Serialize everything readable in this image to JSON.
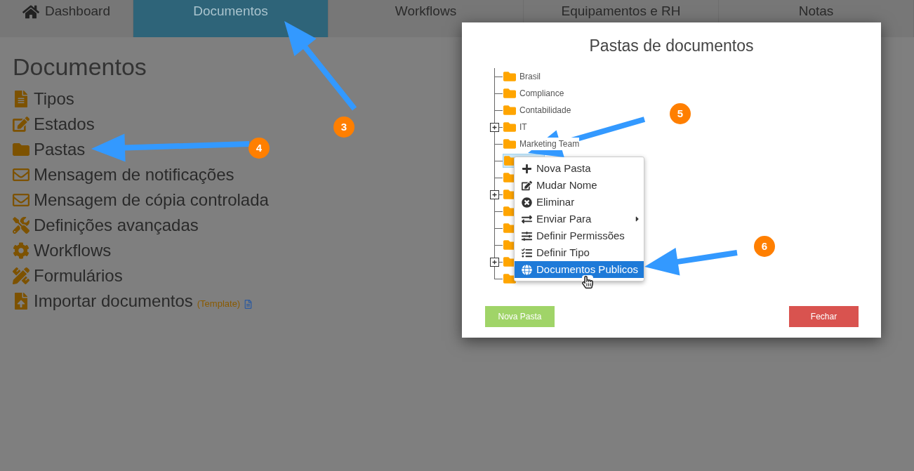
{
  "nav": {
    "tabs": [
      {
        "label": "Dashboard",
        "kind": "home",
        "selected": false
      },
      {
        "label": "Documentos",
        "kind": "plain",
        "selected": true
      },
      {
        "label": "Workflows",
        "kind": "plain",
        "selected": false
      },
      {
        "label": "Equipamentos e RH",
        "kind": "plain",
        "selected": false
      },
      {
        "label": "Notas",
        "kind": "plain",
        "selected": false
      }
    ]
  },
  "sidebar": {
    "title": "Documentos",
    "items": [
      {
        "label": "Tipos"
      },
      {
        "label": "Estados"
      },
      {
        "label": "Pastas"
      },
      {
        "label": "Mensagem de notificações"
      },
      {
        "label": "Mensagem de cópia controlada"
      },
      {
        "label": "Definições avançadas"
      },
      {
        "label": "Workflows"
      },
      {
        "label": "Formulários"
      },
      {
        "label": "Importar documentos",
        "note": "(Template)"
      }
    ]
  },
  "dialog": {
    "title": "Pastas de documentos",
    "tree": [
      {
        "label": "Brasil",
        "expandable": false,
        "selected": false
      },
      {
        "label": "Compliance",
        "expandable": false,
        "selected": false
      },
      {
        "label": "Contabilidade",
        "expandable": false,
        "selected": false
      },
      {
        "label": "IT",
        "expandable": true,
        "selected": false
      },
      {
        "label": "Marketing Team",
        "expandable": false,
        "selected": false
      },
      {
        "expandable": false,
        "selected": true
      },
      {
        "expandable": false,
        "selected": false
      },
      {
        "expandable": true,
        "selected": false
      },
      {
        "expandable": false,
        "selected": false
      },
      {
        "expandable": false,
        "selected": false
      },
      {
        "expandable": false,
        "selected": false
      },
      {
        "expandable": true,
        "selected": false
      },
      {
        "expandable": false,
        "selected": false
      }
    ],
    "context_menu": [
      {
        "label": "Nova Pasta",
        "has_submenu": false,
        "selected": false
      },
      {
        "label": "Mudar Nome",
        "has_submenu": false,
        "selected": false
      },
      {
        "label": "Eliminar",
        "has_submenu": false,
        "selected": false
      },
      {
        "label": "Enviar Para",
        "has_submenu": true,
        "selected": false
      },
      {
        "label": "Definir Permissões",
        "has_submenu": false,
        "selected": false
      },
      {
        "label": "Definir Tipo",
        "has_submenu": false,
        "selected": false
      },
      {
        "label": "Documentos Publicos",
        "has_submenu": false,
        "selected": true
      }
    ],
    "buttons": [
      {
        "label": "Nova Pasta",
        "kind": "primary"
      },
      {
        "label": "Fechar",
        "kind": "danger"
      }
    ]
  },
  "annotations": [
    {
      "number": "3"
    },
    {
      "number": "4"
    },
    {
      "number": "5"
    },
    {
      "number": "6"
    }
  ]
}
